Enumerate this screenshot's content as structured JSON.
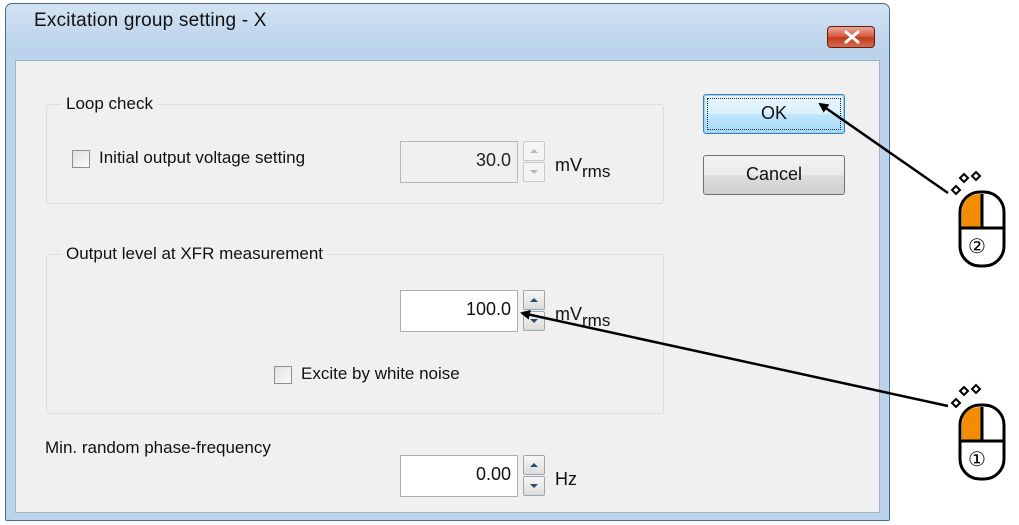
{
  "window": {
    "title": "Excitation group setting - X",
    "close_icon": "close-icon"
  },
  "loop_check": {
    "title": "Loop check",
    "checkbox_label": "Initial output voltage setting",
    "checkbox_checked": false,
    "voltage_value": "30.0",
    "unit_main": "mV",
    "unit_sub": "rms"
  },
  "output_level": {
    "title": "Output level at XFR measurement",
    "level_value": "100.0",
    "unit_main": "mV",
    "unit_sub": "rms",
    "white_noise_label": "Excite by white noise",
    "white_noise_checked": false
  },
  "min_random": {
    "label": "Min. random phase-frequency",
    "value": "0.00",
    "unit": "Hz"
  },
  "buttons": {
    "ok": "OK",
    "cancel": "Cancel"
  },
  "annotations": {
    "mouse_1_number": "①",
    "mouse_2_number": "②",
    "highlight_color": "#f28c00"
  }
}
